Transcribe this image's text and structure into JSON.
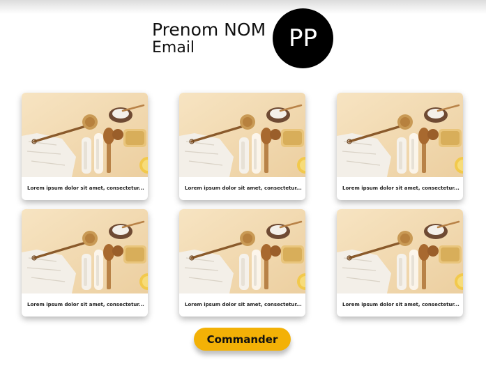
{
  "user": {
    "name": "Prenom NOM",
    "email": "Email",
    "initials": "PP"
  },
  "products": [
    {
      "caption": "Lorem ipsum dolor sit amet, consectetur..."
    },
    {
      "caption": "Lorem ipsum dolor sit amet, consectetur..."
    },
    {
      "caption": "Lorem ipsum dolor sit amet, consectetur..."
    },
    {
      "caption": "Lorem ipsum dolor sit amet, consectetur..."
    },
    {
      "caption": "Lorem ipsum dolor sit amet, consectetur..."
    },
    {
      "caption": "Lorem ipsum dolor sit amet, consectetur..."
    }
  ],
  "actions": {
    "order_label": "Commander"
  },
  "colors": {
    "accent": "#f3b106",
    "avatar_bg": "#000000",
    "image_bg": "#f0d8b0"
  }
}
